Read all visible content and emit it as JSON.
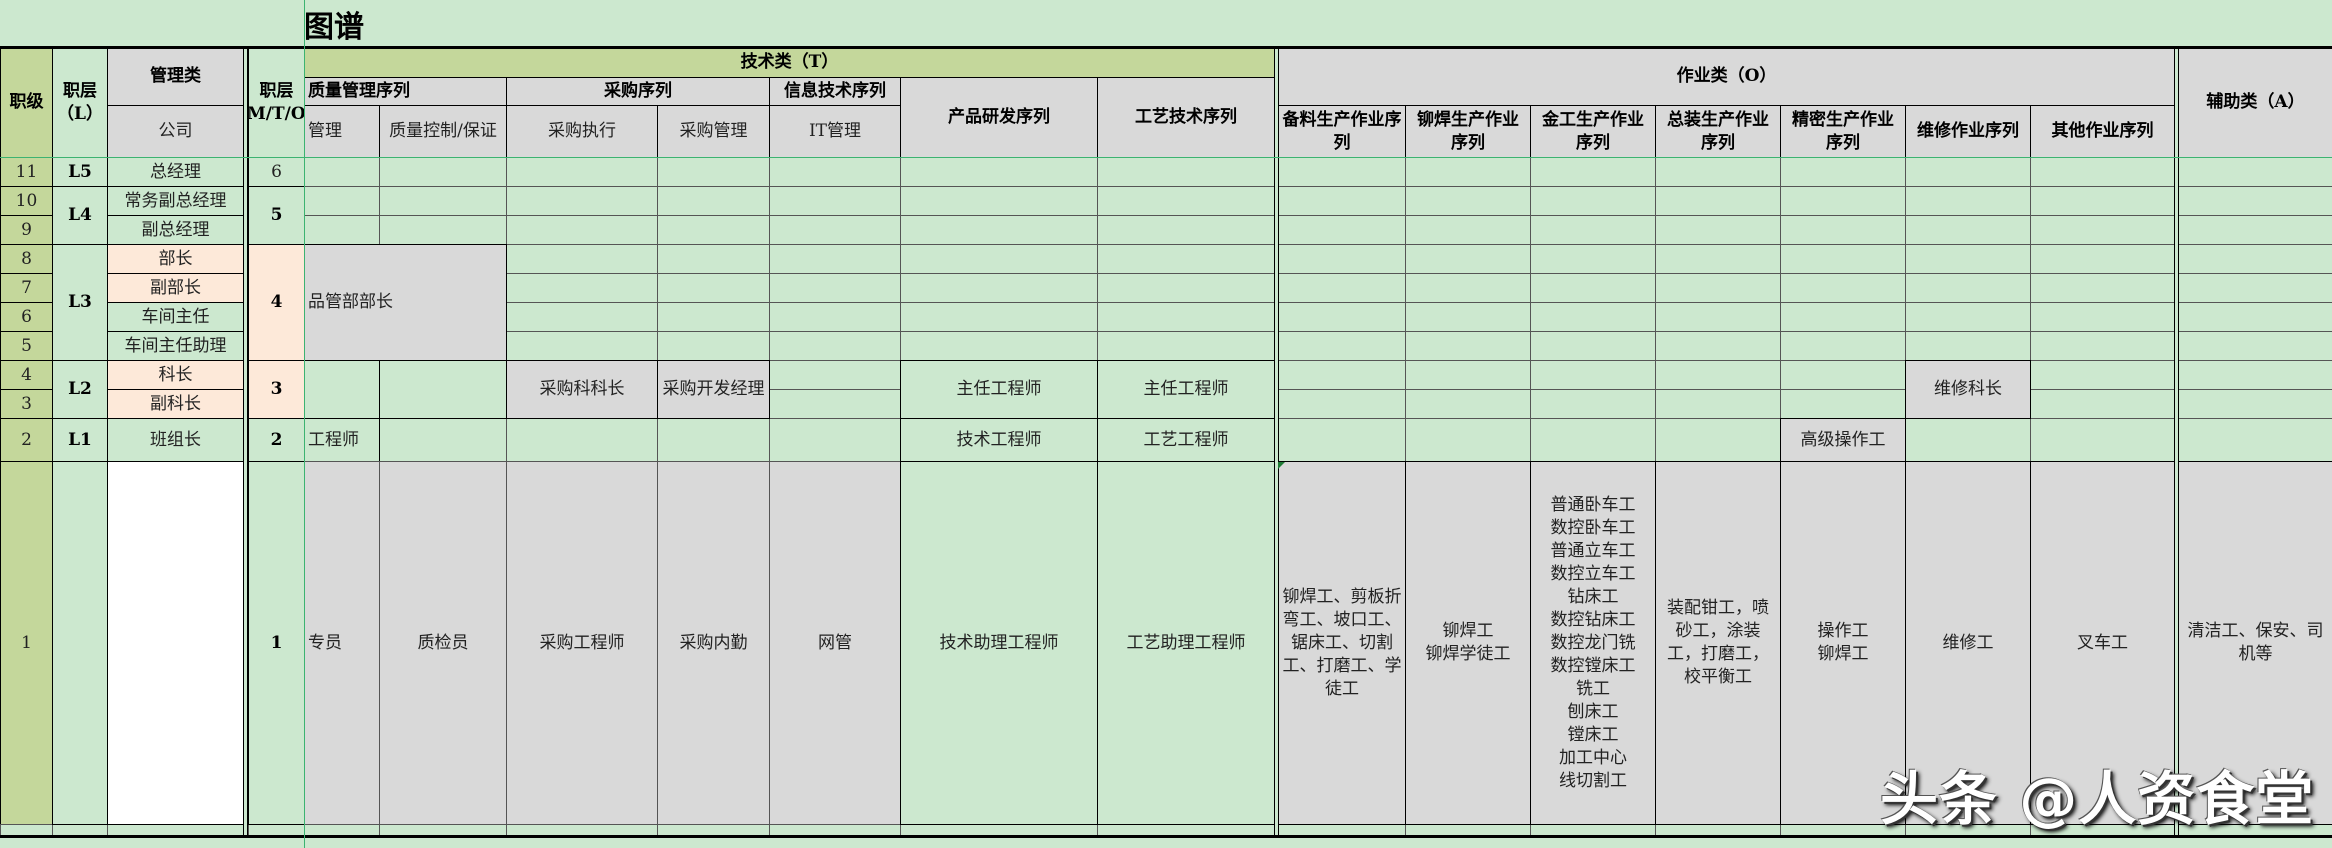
{
  "title": "图谱",
  "headers": {
    "grade": "职级",
    "layer_l": "职层（L）",
    "mgmt": "管理类",
    "company": "公司",
    "layer_pmtoa": "职层（P/M/T/O/A）",
    "tech": "技术类（T）",
    "quality_seq": "质量管理序列",
    "purchase_seq": "采购序列",
    "it_seq": "信息技术序列",
    "rd_seq": "产品研发序列",
    "process_seq": "工艺技术序列",
    "quality_mgmt": "管理",
    "quality_control": "质量控制/保证",
    "purchase_exec": "采购执行",
    "purchase_mgmt": "采购管理",
    "it_mgmt": "IT管理",
    "ops": "作业类（O）",
    "ops_cols": [
      "备料生产作业序列",
      "铆焊生产作业序列",
      "金工生产作业序列",
      "总装生产作业序列",
      "精密生产作业序列",
      "维修作业序列",
      "其他作业序列"
    ],
    "aux": "辅助类（A）"
  },
  "grades": [
    "11",
    "10",
    "9",
    "8",
    "7",
    "6",
    "5",
    "4",
    "3",
    "2",
    "1"
  ],
  "layers": {
    "L5": "L5",
    "L4": "L4",
    "L3": "L3",
    "L2": "L2",
    "L1": "L1"
  },
  "mgmt_titles": [
    "总经理",
    "常务副总经理",
    "副总经理",
    "部长",
    "副部长",
    "车间主任",
    "车间主任助理",
    "科长",
    "副科长",
    "班组长"
  ],
  "pmtoa": {
    "p6": "6",
    "p5": "5",
    "p4": "4",
    "p3": "3",
    "p2": "2",
    "p1": "1"
  },
  "cells": {
    "quality_head": "品管部部长",
    "purchase_section_chief": "采购科科长",
    "purchase_dev_manager": "采购开发经理",
    "rd_chief_engineer": "主任工程师",
    "process_chief_engineer": "主任工程师",
    "maintenance_chief": "维修科长",
    "quality_engineer": "工程师",
    "rd_engineer": "技术工程师",
    "process_engineer": "工艺工程师",
    "senior_operator": "高级操作工"
  },
  "row1": {
    "quality_mgmt": "专员",
    "quality_control": "质检员",
    "purchase_exec": "采购工程师",
    "purchase_mgmt": "采购内勤",
    "it_mgmt": "网管",
    "rd": "技术助理工程师",
    "process": "工艺助理工程师",
    "ops": [
      "铆焊工、剪板折弯工、坡口工、 锯床工、切割工、打磨工、学徒工",
      "铆焊工\n铆焊学徒工",
      "普通卧车工\n数控卧车工\n普通立车工\n数控立车工\n钻床工\n数控钻床工\n数控龙门铣\n数控镗床工\n铣工\n刨床工\n镗床工\n加工中心\n线切割工",
      "装配钳工，喷砂工，涂装工，打磨工，校平衡工",
      "操作工\n铆焊工",
      "维修工",
      "叉车工"
    ],
    "aux": "清洁工、保安、司机等"
  },
  "watermark": "头条 @人资食堂"
}
